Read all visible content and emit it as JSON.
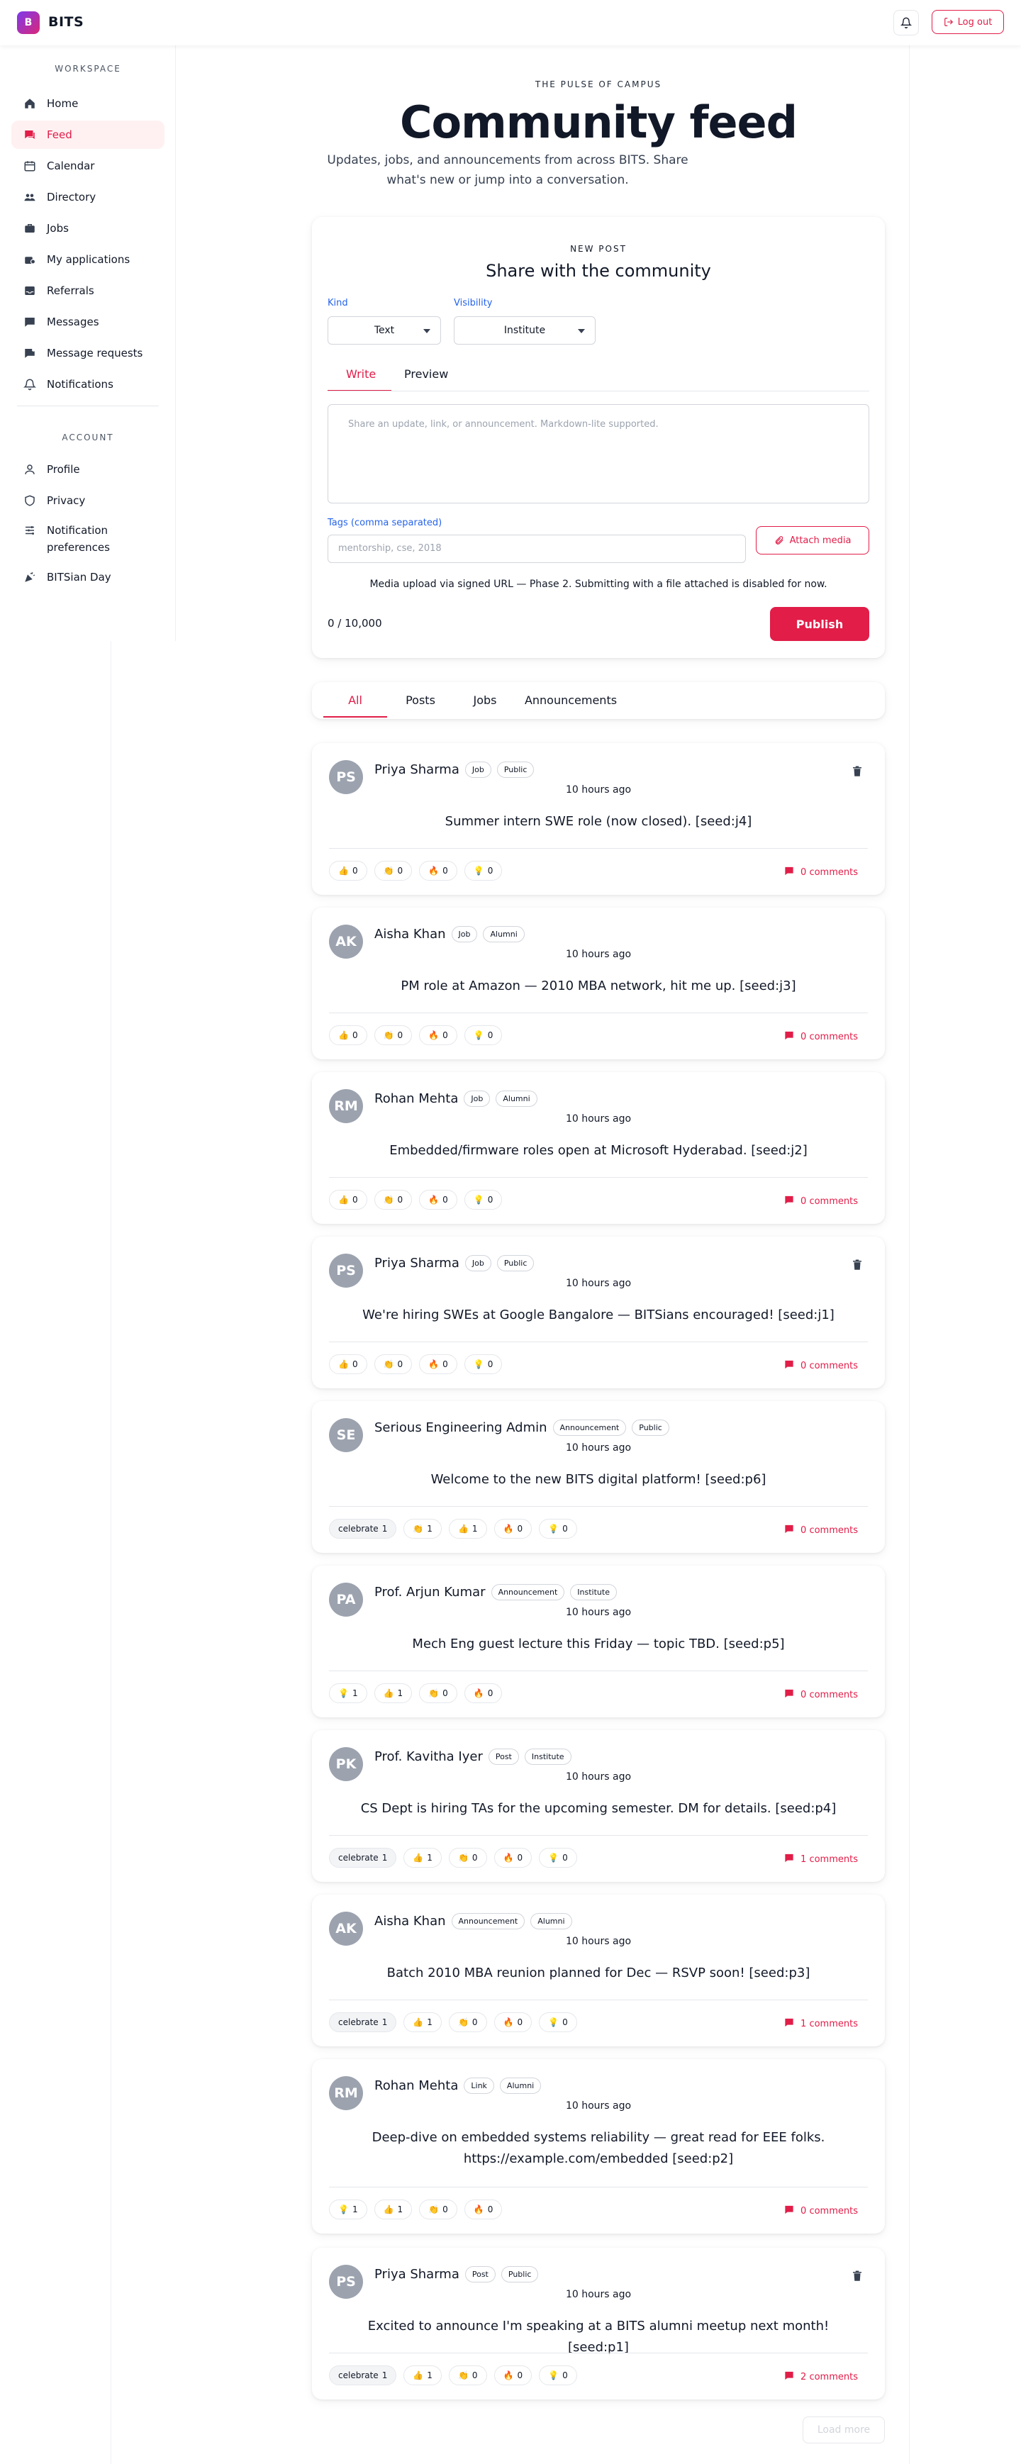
{
  "app": {
    "logo_letter": "B",
    "name": "BITS"
  },
  "header": {
    "logout_label": "Log out"
  },
  "sidebar": {
    "workspace_label": "WORKSPACE",
    "workspace_items": [
      {
        "label": "Home",
        "icon": "home-icon"
      },
      {
        "label": "Feed",
        "icon": "feed-icon",
        "active": true
      },
      {
        "label": "Calendar",
        "icon": "calendar-icon"
      },
      {
        "label": "Directory",
        "icon": "directory-icon"
      },
      {
        "label": "Jobs",
        "icon": "briefcase-icon"
      },
      {
        "label": "My applications",
        "icon": "applications-icon"
      },
      {
        "label": "Referrals",
        "icon": "inbox-icon"
      },
      {
        "label": "Messages",
        "icon": "message-icon"
      },
      {
        "label": "Message requests",
        "icon": "message-request-icon"
      },
      {
        "label": "Notifications",
        "icon": "bell-icon"
      }
    ],
    "account_label": "ACCOUNT",
    "account_items": [
      {
        "label": "Profile",
        "icon": "user-icon"
      },
      {
        "label": "Privacy",
        "icon": "shield-icon"
      },
      {
        "label": "Notification preferences",
        "icon": "sliders-icon"
      },
      {
        "label": "BITSian Day",
        "icon": "party-icon"
      }
    ]
  },
  "hero": {
    "eyebrow": "THE PULSE OF CAMPUS",
    "title": "Community feed",
    "subtitle": "Updates, jobs, and announcements from across BITS. Share what's new or jump into a conversation."
  },
  "composer": {
    "eyebrow": "NEW POST",
    "title": "Share with the community",
    "kind_label": "Kind",
    "kind_value": "Text",
    "visibility_label": "Visibility",
    "visibility_value": "Institute",
    "write_tab": "Write",
    "preview_tab": "Preview",
    "body_placeholder": "Share an update, link, or announcement. Markdown-lite supported.",
    "tags_label": "Tags (comma separated)",
    "tags_placeholder": "mentorship, cse, 2018",
    "attach_label": "Attach media",
    "note": "Media upload via signed URL — Phase 2. Submitting with a file attached is disabled for now.",
    "counter": "0 / 10,000",
    "publish_label": "Publish"
  },
  "filters": [
    "All",
    "Posts",
    "Jobs",
    "Announcements"
  ],
  "posts": [
    {
      "initials": "PS",
      "author": "Priya Sharma",
      "type": "Job",
      "visibility": "Public",
      "time": "10 hours ago",
      "body": "Summer intern SWE role (now closed). [seed:j4]",
      "deletable": true,
      "reactions": [
        {
          "emoji": "👍",
          "count": "0"
        },
        {
          "emoji": "👏",
          "count": "0"
        },
        {
          "emoji": "🔥",
          "count": "0"
        },
        {
          "emoji": "💡",
          "count": "0"
        }
      ],
      "comments": "0 comments"
    },
    {
      "initials": "AK",
      "author": "Aisha Khan",
      "type": "Job",
      "visibility": "Alumni",
      "time": "10 hours ago",
      "body": "PM role at Amazon — 2010 MBA network, hit me up. [seed:j3]",
      "deletable": false,
      "reactions": [
        {
          "emoji": "👍",
          "count": "0"
        },
        {
          "emoji": "👏",
          "count": "0"
        },
        {
          "emoji": "🔥",
          "count": "0"
        },
        {
          "emoji": "💡",
          "count": "0"
        }
      ],
      "comments": "0 comments"
    },
    {
      "initials": "RM",
      "author": "Rohan Mehta",
      "type": "Job",
      "visibility": "Alumni",
      "time": "10 hours ago",
      "body": "Embedded/firmware roles open at Microsoft Hyderabad. [seed:j2]",
      "deletable": false,
      "reactions": [
        {
          "emoji": "👍",
          "count": "0"
        },
        {
          "emoji": "👏",
          "count": "0"
        },
        {
          "emoji": "🔥",
          "count": "0"
        },
        {
          "emoji": "💡",
          "count": "0"
        }
      ],
      "comments": "0 comments"
    },
    {
      "initials": "PS",
      "author": "Priya Sharma",
      "type": "Job",
      "visibility": "Public",
      "time": "10 hours ago",
      "body": "We're hiring SWEs at Google Bangalore — BITSians encouraged! [seed:j1]",
      "deletable": true,
      "reactions": [
        {
          "emoji": "👍",
          "count": "0"
        },
        {
          "emoji": "👏",
          "count": "0"
        },
        {
          "emoji": "🔥",
          "count": "0"
        },
        {
          "emoji": "💡",
          "count": "0"
        }
      ],
      "comments": "0 comments"
    },
    {
      "initials": "SE",
      "author": "Serious Engineering Admin",
      "type": "Announcement",
      "visibility": "Public",
      "time": "10 hours ago",
      "body": "Welcome to the new BITS digital platform! [seed:p6]",
      "deletable": false,
      "reactions": [
        {
          "emoji": "celebrate",
          "count": "1"
        },
        {
          "emoji": "👏",
          "count": "1"
        },
        {
          "emoji": "👍",
          "count": "1"
        },
        {
          "emoji": "🔥",
          "count": "0"
        },
        {
          "emoji": "💡",
          "count": "0"
        }
      ],
      "comments": "0 comments"
    },
    {
      "initials": "PA",
      "author": "Prof. Arjun Kumar",
      "type": "Announcement",
      "visibility": "Institute",
      "time": "10 hours ago",
      "body": "Mech Eng guest lecture this Friday — topic TBD. [seed:p5]",
      "deletable": false,
      "reactions": [
        {
          "emoji": "💡",
          "count": "1"
        },
        {
          "emoji": "👍",
          "count": "1"
        },
        {
          "emoji": "👏",
          "count": "0"
        },
        {
          "emoji": "🔥",
          "count": "0"
        }
      ],
      "comments": "0 comments"
    },
    {
      "initials": "PK",
      "author": "Prof. Kavitha Iyer",
      "type": "Post",
      "visibility": "Institute",
      "time": "10 hours ago",
      "body": "CS Dept is hiring TAs for the upcoming semester. DM for details. [seed:p4]",
      "deletable": false,
      "reactions": [
        {
          "emoji": "celebrate",
          "count": "1"
        },
        {
          "emoji": "👍",
          "count": "1"
        },
        {
          "emoji": "👏",
          "count": "0"
        },
        {
          "emoji": "🔥",
          "count": "0"
        },
        {
          "emoji": "💡",
          "count": "0"
        }
      ],
      "comments": "1 comments"
    },
    {
      "initials": "AK",
      "author": "Aisha Khan",
      "type": "Announcement",
      "visibility": "Alumni",
      "time": "10 hours ago",
      "body": "Batch 2010 MBA reunion planned for Dec — RSVP soon! [seed:p3]",
      "deletable": false,
      "reactions": [
        {
          "emoji": "celebrate",
          "count": "1"
        },
        {
          "emoji": "👍",
          "count": "1"
        },
        {
          "emoji": "👏",
          "count": "0"
        },
        {
          "emoji": "🔥",
          "count": "0"
        },
        {
          "emoji": "💡",
          "count": "0"
        }
      ],
      "comments": "1 comments"
    },
    {
      "initials": "RM",
      "author": "Rohan Mehta",
      "type": "Link",
      "visibility": "Alumni",
      "time": "10 hours ago",
      "body": "Deep-dive on embedded systems reliability — great read for EEE folks. https://example.com/embedded [seed:p2]",
      "deletable": false,
      "reactions": [
        {
          "emoji": "💡",
          "count": "1"
        },
        {
          "emoji": "👍",
          "count": "1"
        },
        {
          "emoji": "👏",
          "count": "0"
        },
        {
          "emoji": "🔥",
          "count": "0"
        }
      ],
      "comments": "0 comments"
    },
    {
      "initials": "PS",
      "author": "Priya Sharma",
      "type": "Post",
      "visibility": "Public",
      "time": "10 hours ago",
      "body": "Excited to announce I'm speaking at a BITS alumni meetup next month! [seed:p1]",
      "deletable": true,
      "reactions": [
        {
          "emoji": "celebrate",
          "count": "1"
        },
        {
          "emoji": "👍",
          "count": "1"
        },
        {
          "emoji": "👏",
          "count": "0"
        },
        {
          "emoji": "🔥",
          "count": "0"
        },
        {
          "emoji": "💡",
          "count": "0"
        }
      ],
      "comments": "2 comments"
    }
  ],
  "load_more_label": "Load more",
  "colors": {
    "accent": "#e11d48",
    "link": "#2563eb",
    "active_bg": "#fff1f2"
  }
}
